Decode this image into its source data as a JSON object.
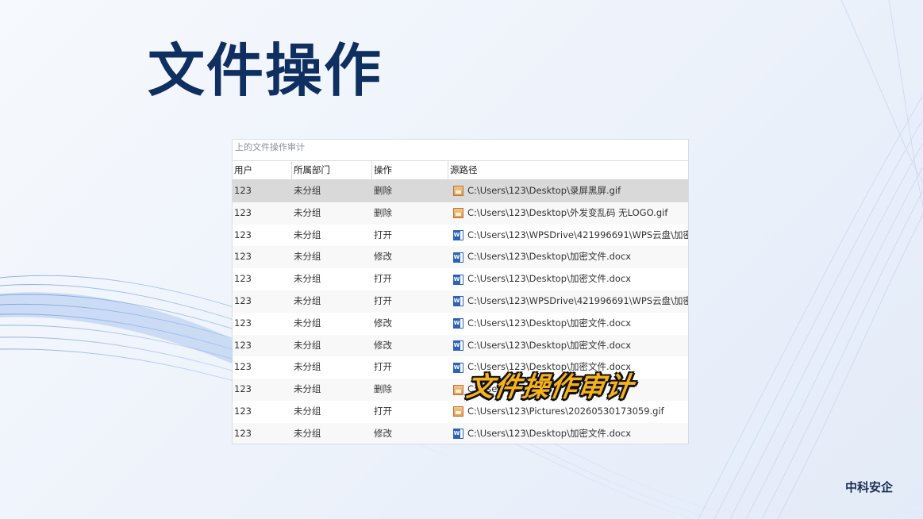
{
  "slide": {
    "title": "文件操作",
    "brand": "中科安企",
    "overlay_caption": "文件操作审计"
  },
  "window": {
    "title": "上的文件操作审计"
  },
  "table": {
    "columns": [
      "用户",
      "所属部门",
      "操作",
      "源路径"
    ],
    "rows": [
      {
        "user": "123",
        "dept": "未分组",
        "op": "删除",
        "path": "C:\\Users\\123\\Desktop\\录屏黑屏.gif",
        "icon": "gif-file-icon"
      },
      {
        "user": "123",
        "dept": "未分组",
        "op": "删除",
        "path": "C:\\Users\\123\\Desktop\\外发变乱码 无LOGO.gif",
        "icon": "gif-file-icon"
      },
      {
        "user": "123",
        "dept": "未分组",
        "op": "打开",
        "path": "C:\\Users\\123\\WPSDrive\\421996691\\WPS云盘\\加密文",
        "icon": "word-file-icon"
      },
      {
        "user": "123",
        "dept": "未分组",
        "op": "修改",
        "path": "C:\\Users\\123\\Desktop\\加密文件.docx",
        "icon": "word-file-icon"
      },
      {
        "user": "123",
        "dept": "未分组",
        "op": "打开",
        "path": "C:\\Users\\123\\Desktop\\加密文件.docx",
        "icon": "word-file-icon"
      },
      {
        "user": "123",
        "dept": "未分组",
        "op": "打开",
        "path": "C:\\Users\\123\\WPSDrive\\421996691\\WPS云盘\\加密文",
        "icon": "word-file-icon"
      },
      {
        "user": "123",
        "dept": "未分组",
        "op": "修改",
        "path": "C:\\Users\\123\\Desktop\\加密文件.docx",
        "icon": "word-file-icon"
      },
      {
        "user": "123",
        "dept": "未分组",
        "op": "修改",
        "path": "C:\\Users\\123\\Desktop\\加密文件.docx",
        "icon": "word-file-icon"
      },
      {
        "user": "123",
        "dept": "未分组",
        "op": "打开",
        "path": "C:\\Users\\123\\Desktop\\加密文件.docx",
        "icon": "word-file-icon"
      },
      {
        "user": "123",
        "dept": "未分组",
        "op": "删除",
        "path": "C:\\Users\\12",
        "icon": "gif-file-icon"
      },
      {
        "user": "123",
        "dept": "未分组",
        "op": "打开",
        "path": "C:\\Users\\123\\Pictures\\20260530173059.gif",
        "icon": "gif-file-icon"
      },
      {
        "user": "123",
        "dept": "未分组",
        "op": "修改",
        "path": "C:\\Users\\123\\Desktop\\加密文件.docx",
        "icon": "word-file-icon"
      }
    ]
  },
  "colors": {
    "title": "#0e2f60",
    "selected_row": "#d9d9d9",
    "overlay_text": "#f6b21d"
  }
}
